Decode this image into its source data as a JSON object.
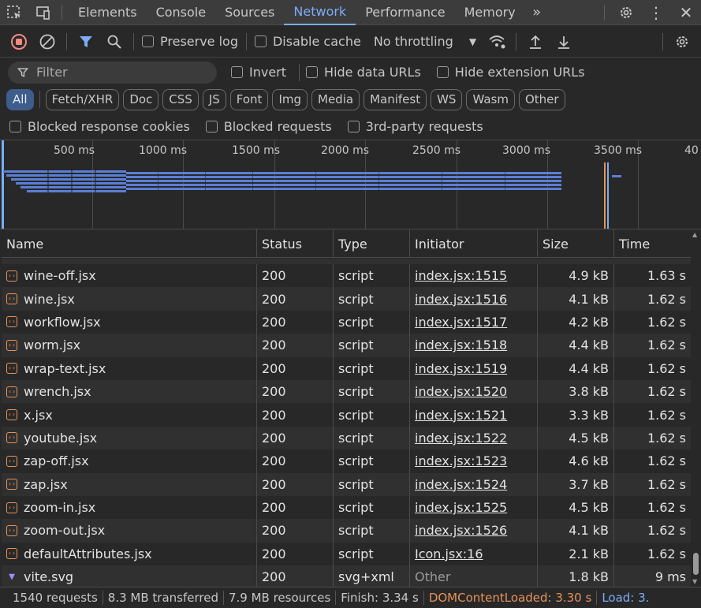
{
  "tabs": [
    {
      "label": "Elements"
    },
    {
      "label": "Console"
    },
    {
      "label": "Sources"
    },
    {
      "label": "Network",
      "active": true
    },
    {
      "label": "Performance"
    },
    {
      "label": "Memory"
    }
  ],
  "toolbar": {
    "preserve_log": "Preserve log",
    "disable_cache": "Disable cache",
    "throttling": "No throttling"
  },
  "filter": {
    "placeholder": "Filter",
    "invert": "Invert",
    "hide_data_urls": "Hide data URLs",
    "hide_extension_urls": "Hide extension URLs"
  },
  "type_chips": [
    "All",
    "Fetch/XHR",
    "Doc",
    "CSS",
    "JS",
    "Font",
    "Img",
    "Media",
    "Manifest",
    "WS",
    "Wasm",
    "Other"
  ],
  "checkbox_row": {
    "blocked_cookies": "Blocked response cookies",
    "blocked_requests": "Blocked requests",
    "third_party": "3rd-party requests"
  },
  "timeline": {
    "ticks": [
      "500 ms",
      "1000 ms",
      "1500 ms",
      "2000 ms",
      "2500 ms",
      "3000 ms",
      "3500 ms",
      "40"
    ],
    "bar_color": "#5b7fd6",
    "dcl_color": "#e8925a",
    "load_color": "#7cacf8"
  },
  "table": {
    "headers": {
      "name": "Name",
      "status": "Status",
      "type": "Type",
      "initiator": "Initiator",
      "size": "Size",
      "time": "Time"
    },
    "rows": [
      {
        "name": "wine-off.jsx",
        "status": "200",
        "type": "script",
        "initiator": "index.jsx:1515",
        "size": "4.9 kB",
        "time": "1.63 s"
      },
      {
        "name": "wine.jsx",
        "status": "200",
        "type": "script",
        "initiator": "index.jsx:1516",
        "size": "4.1 kB",
        "time": "1.62 s"
      },
      {
        "name": "workflow.jsx",
        "status": "200",
        "type": "script",
        "initiator": "index.jsx:1517",
        "size": "4.2 kB",
        "time": "1.62 s"
      },
      {
        "name": "worm.jsx",
        "status": "200",
        "type": "script",
        "initiator": "index.jsx:1518",
        "size": "4.4 kB",
        "time": "1.62 s"
      },
      {
        "name": "wrap-text.jsx",
        "status": "200",
        "type": "script",
        "initiator": "index.jsx:1519",
        "size": "4.4 kB",
        "time": "1.62 s"
      },
      {
        "name": "wrench.jsx",
        "status": "200",
        "type": "script",
        "initiator": "index.jsx:1520",
        "size": "3.8 kB",
        "time": "1.62 s"
      },
      {
        "name": "x.jsx",
        "status": "200",
        "type": "script",
        "initiator": "index.jsx:1521",
        "size": "3.3 kB",
        "time": "1.62 s"
      },
      {
        "name": "youtube.jsx",
        "status": "200",
        "type": "script",
        "initiator": "index.jsx:1522",
        "size": "4.5 kB",
        "time": "1.62 s"
      },
      {
        "name": "zap-off.jsx",
        "status": "200",
        "type": "script",
        "initiator": "index.jsx:1523",
        "size": "4.6 kB",
        "time": "1.62 s"
      },
      {
        "name": "zap.jsx",
        "status": "200",
        "type": "script",
        "initiator": "index.jsx:1524",
        "size": "3.7 kB",
        "time": "1.62 s"
      },
      {
        "name": "zoom-in.jsx",
        "status": "200",
        "type": "script",
        "initiator": "index.jsx:1525",
        "size": "4.5 kB",
        "time": "1.62 s"
      },
      {
        "name": "zoom-out.jsx",
        "status": "200",
        "type": "script",
        "initiator": "index.jsx:1526",
        "size": "4.1 kB",
        "time": "1.62 s"
      },
      {
        "name": "defaultAttributes.jsx",
        "status": "200",
        "type": "script",
        "initiator": "Icon.jsx:16",
        "size": "2.1 kB",
        "time": "1.62 s"
      },
      {
        "name": "vite.svg",
        "status": "200",
        "type": "svg+xml",
        "initiator": "Other",
        "size": "1.8 kB",
        "time": "9 ms",
        "svg": true
      }
    ]
  },
  "status_bar": {
    "requests": "1540 requests",
    "transferred": "8.3 MB transferred",
    "resources": "7.9 MB resources",
    "finish": "Finish: 3.34 s",
    "dcl": "DOMContentLoaded: 3.30 s",
    "load": "Load: 3."
  }
}
